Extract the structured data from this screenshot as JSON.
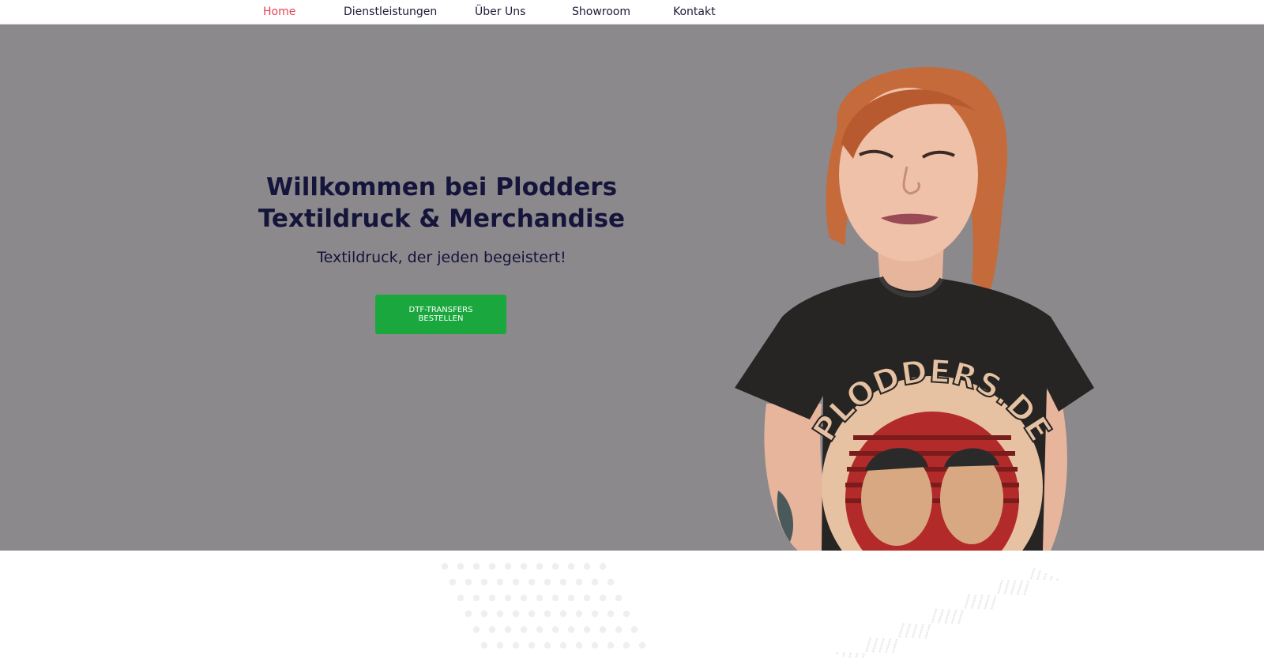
{
  "nav": {
    "items": [
      {
        "label": "Home",
        "active": true
      },
      {
        "label": "Dienstleistungen",
        "active": false
      },
      {
        "label": "Über Uns",
        "active": false
      },
      {
        "label": "Showroom",
        "active": false
      },
      {
        "label": "Kontakt",
        "active": false
      }
    ]
  },
  "hero": {
    "title_line1": "Willkommen bei Plodders",
    "title_line2": "Textildruck & Merchandise",
    "subtitle": "Textildruck, der jeden begeistert!",
    "cta_label": "DTF-TRANSFERS BESTELLEN",
    "shirt_print_text": "PLODDERS.DE"
  },
  "colors": {
    "nav_active": "#e8424f",
    "nav_text": "#1b1b3a",
    "hero_bg": "#8b898c",
    "heading": "#15143a",
    "cta_bg": "#1aa83e",
    "cta_text": "#ffffff"
  }
}
